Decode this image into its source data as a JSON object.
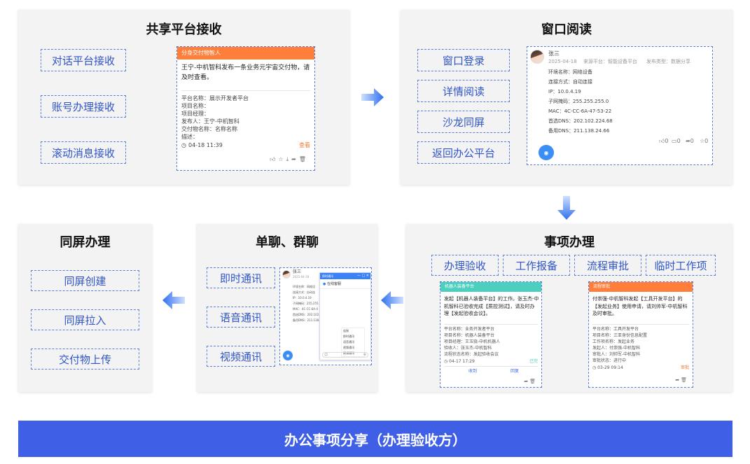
{
  "banner": "办公事项分享（办理验收方）",
  "panel1": {
    "title": "共享平台接收",
    "tags": [
      "对话平台接收",
      "账号办理接收",
      "滚动消息接收"
    ],
    "card": {
      "header": "分身交付物智人",
      "message": "王宁-中机智科发布一条业务元宇宙交付物，请及时查看。",
      "fields": [
        "平台名称：展示开发者平台",
        "项目名称：",
        "项目经理：",
        "发布人：王宁-中机智科",
        "交付物名称：名称名称",
        "描述："
      ],
      "time": "04-18 11:39",
      "action": "查看"
    }
  },
  "panel2": {
    "title": "窗口阅读",
    "tags": [
      "窗口登录",
      "详情阅读",
      "沙龙同屏",
      "返回办公平台"
    ],
    "card": {
      "name": "张三",
      "meta": [
        "2025-04-18",
        "来源平台：智能设备平台",
        "发布类型：数据分享"
      ],
      "fields": [
        "环境名称：网络设备",
        "连接方式：自动连接",
        "IP：10.0.4.19",
        "子网掩码：255.255.255.0",
        "MAC：4C-CC-6A-47-53-22",
        "首选DNS：202.102.224.68",
        "备用DNS：211.138.24.66"
      ],
      "counts": [
        "0",
        "0",
        "0",
        "0"
      ]
    }
  },
  "panel3": {
    "title": "事项办理",
    "tags": [
      "办理验收",
      "工作报备",
      "流程审批",
      "临时工作项"
    ],
    "card1": {
      "header": "机器人装备平台",
      "message": "发起【机器人装备平台】的工作。张玉杰-中机智科已验收完成【质控测试】，请及时办理【发起验收会议】。",
      "fields": [
        "平台名称：业务开发者平台",
        "项目名称：机器人装备平台",
        "项目经理：王玉骁-中机机器人",
        "验收人：张玉杰-中机智科",
        "流程状态名称：发起验收会议"
      ],
      "time": "04-17 17:29",
      "status": "已完",
      "btn1": "收到",
      "btn2": "回复"
    },
    "card2": {
      "header": "流程审批",
      "message": "付崇强-中机智科发起【工具开发平台】的【发起业务】使用申请，请刘帅军-中机智科及时审批。",
      "fields": [
        "平台名称：工具开发平台",
        "项目名称：三亚身份信息配置",
        "工作项名称：发起业务",
        "发起人：付崇强-中机智科",
        "审批人：刘帅军-中机智科",
        "审批状态：进行中"
      ],
      "time": "03-29 09:14",
      "status": "审批"
    }
  },
  "panel4": {
    "title": "单聊、群聊",
    "tags": [
      "即时通讯",
      "语音通讯",
      "视频通讯"
    ],
    "chat": {
      "name": "张三",
      "meta": "2025-04-18",
      "fields": [
        "环境名称：网络设",
        "连接方式：自动连",
        "IP：10.0.4.19",
        "子网掩码：255.255.",
        "MAC：4C-CC-6A-4",
        "首选DNS：202.102.",
        "备用DNS：211.138."
      ],
      "popup_header": "即时通讯",
      "popup_title": "在线客服",
      "menu": [
        "连接",
        "即时通讯",
        "语音通讯",
        "视频通讯",
        "视频通讯"
      ]
    }
  },
  "panel5": {
    "title": "同屏办理",
    "tags": [
      "同屏创建",
      "同屏拉入",
      "交付物上传"
    ]
  },
  "colors": {
    "accent": "#3e5fe6",
    "tag_text": "#2f55c9",
    "orange": "#ff7f3a",
    "teal": "#4ccfbe",
    "arrow": "#3b82f6"
  }
}
